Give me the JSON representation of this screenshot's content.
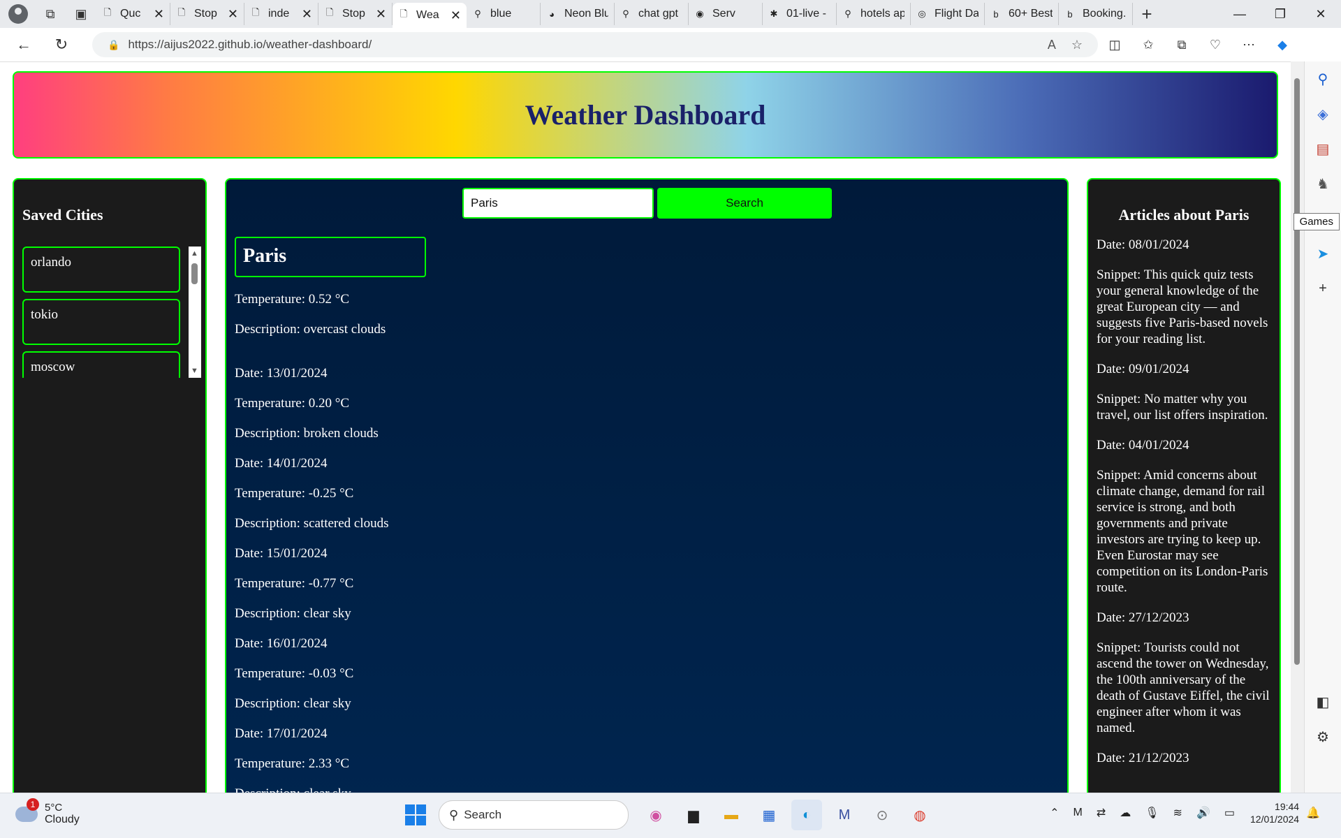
{
  "browser": {
    "tabs": [
      {
        "title": "Quc",
        "icon": "document-icon"
      },
      {
        "title": "Stop",
        "icon": "document-icon"
      },
      {
        "title": "inde",
        "icon": "document-icon"
      },
      {
        "title": "Stop",
        "icon": "document-icon"
      },
      {
        "title": "Wea",
        "icon": "document-icon",
        "active": true
      },
      {
        "title": "blue",
        "icon": "search-icon"
      },
      {
        "title": "Neon Blu",
        "icon": "palette-icon"
      },
      {
        "title": "chat gpt",
        "icon": "search-icon"
      },
      {
        "title": "Serv",
        "icon": "record-icon"
      },
      {
        "title": "01-live -",
        "icon": "slack-icon"
      },
      {
        "title": "hotels ap",
        "icon": "search-icon"
      },
      {
        "title": "Flight Da",
        "icon": "globe-icon"
      },
      {
        "title": "60+ Best",
        "icon": "booking-icon"
      },
      {
        "title": "Booking.",
        "icon": "booking-icon"
      }
    ],
    "url": "https://aijus2022.github.io/weather-dashboard/",
    "sidebar_tooltip": "Games"
  },
  "header": {
    "title": "Weather Dashboard"
  },
  "saved_cities": {
    "title": "Saved Cities",
    "items": [
      "orlando",
      "tokio",
      "moscow"
    ]
  },
  "search": {
    "value": "Paris",
    "button_label": "Search"
  },
  "current": {
    "city": "Paris",
    "temperature": "Temperature: 0.52 °C",
    "description": "Description: overcast clouds"
  },
  "forecast": [
    {
      "date": "Date: 13/01/2024",
      "temperature": "Temperature: 0.20 °C",
      "description": "Description: broken clouds"
    },
    {
      "date": "Date: 14/01/2024",
      "temperature": "Temperature: -0.25 °C",
      "description": "Description: scattered clouds"
    },
    {
      "date": "Date: 15/01/2024",
      "temperature": "Temperature: -0.77 °C",
      "description": "Description: clear sky"
    },
    {
      "date": "Date: 16/01/2024",
      "temperature": "Temperature: -0.03 °C",
      "description": "Description: clear sky"
    },
    {
      "date": "Date: 17/01/2024",
      "temperature": "Temperature: 2.33 °C",
      "description": "Description: clear sky"
    }
  ],
  "articles": {
    "title": "Articles about Paris",
    "items": [
      {
        "date": "Date: 08/01/2024",
        "snippet": "Snippet: This quick quiz tests your general knowledge of the great European city — and suggests five Paris-based novels for your reading list."
      },
      {
        "date": "Date: 09/01/2024",
        "snippet": "Snippet: No matter why you travel, our list offers inspiration."
      },
      {
        "date": "Date: 04/01/2024",
        "snippet": "Snippet: Amid concerns about climate change, demand for rail service is strong, and both governments and private investors are trying to keep up. Even Eurostar may see competition on its London-Paris route."
      },
      {
        "date": "Date: 27/12/2023",
        "snippet": "Snippet: Tourists could not ascend the tower on Wednesday, the 100th anniversary of the death of Gustave Eiffel, the civil engineer after whom it was named."
      },
      {
        "date": "Date: 21/12/2023",
        "snippet": ""
      }
    ]
  },
  "taskbar": {
    "weather_temp": "5°C",
    "weather_desc": "Cloudy",
    "weather_badge": "1",
    "search_label": "Search",
    "time": "19:44",
    "date": "12/01/2024"
  },
  "colors": {
    "accent": "#00ff00",
    "panel": "#1b1b1b",
    "main_bg": "#002147",
    "title": "#1a2169"
  }
}
